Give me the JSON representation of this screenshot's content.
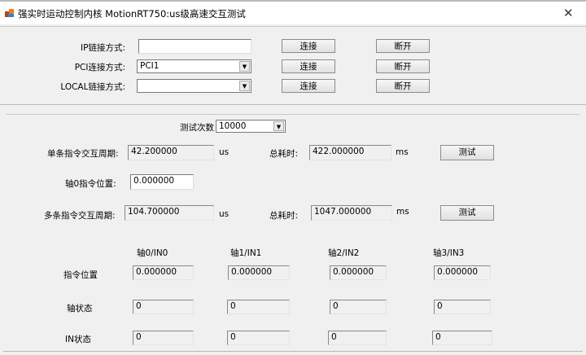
{
  "window": {
    "title": "强实时运动控制内核 MotionRT750:us级高速交互测试",
    "close": "✕"
  },
  "connection": {
    "ip_label": "IP链接方式:",
    "ip_value": "",
    "pci_label": "PCI连接方式:",
    "pci_value": "PCI1",
    "local_label": "LOCAL链接方式:",
    "local_value": "",
    "connect_label": "连接",
    "disconnect_label": "断开"
  },
  "test": {
    "count_label": "测试次数",
    "count_value": "10000",
    "single_label": "单条指令交互周期:",
    "single_value": "42.200000",
    "single_unit": "us",
    "single_total_label": "总耗时:",
    "single_total_value": "422.000000",
    "single_total_unit": "ms",
    "test_label": "测试",
    "axis0_label": "轴0指令位置:",
    "axis0_value": "0.000000",
    "multi_label": "多条指令交互周期:",
    "multi_value": "104.700000",
    "multi_unit": "us",
    "multi_total_label": "总耗时:",
    "multi_total_value": "1047.000000",
    "multi_total_unit": "ms"
  },
  "status": {
    "columns": [
      "轴0/IN0",
      "轴1/IN1",
      "轴2/IN2",
      "轴3/IN3"
    ],
    "rows": [
      {
        "label": "指令位置",
        "values": [
          "0.000000",
          "0.000000",
          "0.000000",
          "0.000000"
        ]
      },
      {
        "label": "轴状态",
        "values": [
          "0",
          "0",
          "0",
          "0"
        ]
      },
      {
        "label": "IN状态",
        "values": [
          "0",
          "0",
          "0",
          "0"
        ]
      }
    ]
  }
}
